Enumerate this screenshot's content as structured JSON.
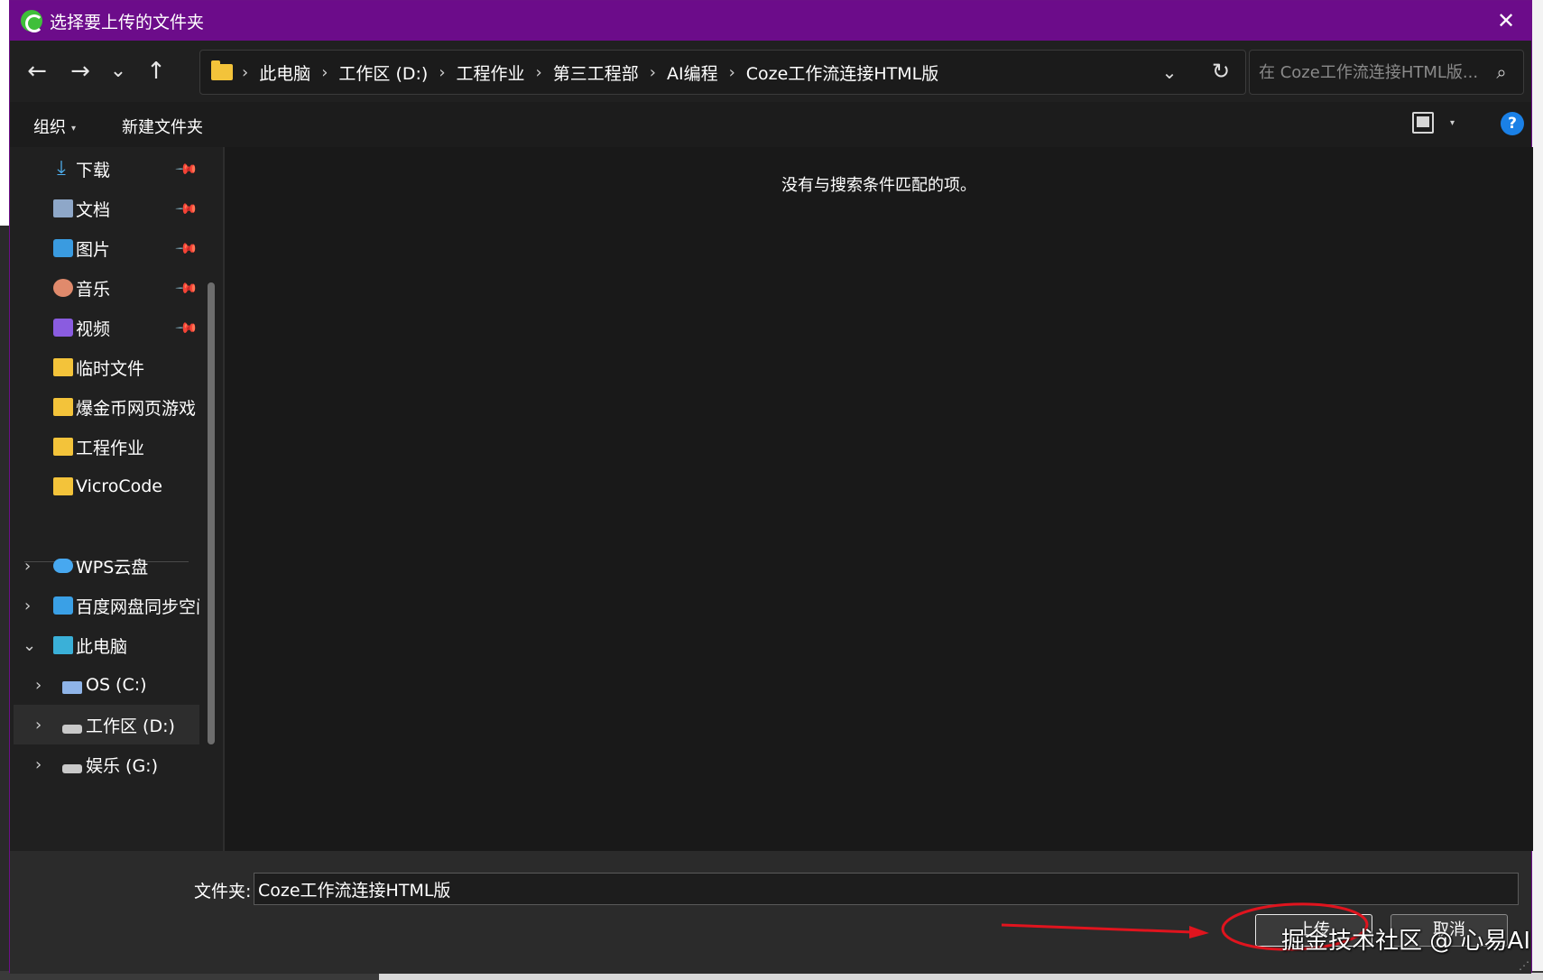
{
  "window": {
    "title": "选择要上传的文件夹",
    "close_glyph": "✕"
  },
  "nav": {
    "back_glyph": "←",
    "forward_glyph": "→",
    "recent_glyph": "⌄",
    "up_glyph": "↑",
    "breadcrumbs": [
      "此电脑",
      "工作区 (D:)",
      "工程作业",
      "第三工程部",
      "AI编程",
      "Coze工作流连接HTML版"
    ],
    "separator": "›",
    "dropdown_glyph": "⌄",
    "refresh_glyph": "↻",
    "search_placeholder": "在 Coze工作流连接HTML版...",
    "search_glyph": "⌕"
  },
  "toolbar": {
    "organize_label": "组织",
    "new_folder_label": "新建文件夹",
    "caret": "▾",
    "help_glyph": "?"
  },
  "sidebar": {
    "pin_glyph": "📌",
    "expand_glyph": "›",
    "collapse_glyph": "⌄",
    "quick_access": [
      {
        "label": "下载",
        "icon": "download-icon",
        "pinned": true
      },
      {
        "label": "文档",
        "icon": "document-icon",
        "pinned": true
      },
      {
        "label": "图片",
        "icon": "pictures-icon",
        "pinned": true
      },
      {
        "label": "音乐",
        "icon": "music-icon",
        "pinned": true
      },
      {
        "label": "视频",
        "icon": "video-icon",
        "pinned": true
      },
      {
        "label": "临时文件",
        "icon": "folder-icon",
        "pinned": false
      },
      {
        "label": "爆金币网页游戏",
        "icon": "folder-icon",
        "pinned": false
      },
      {
        "label": "工程作业",
        "icon": "folder-icon",
        "pinned": false
      },
      {
        "label": "VicroCode",
        "icon": "folder-icon",
        "pinned": false
      }
    ],
    "locations": [
      {
        "label": "WPS云盘",
        "icon": "cloud-icon",
        "expanded": false
      },
      {
        "label": "百度网盘同步空间",
        "icon": "baidu-netdisk-icon",
        "expanded": false
      },
      {
        "label": "此电脑",
        "icon": "computer-icon",
        "expanded": true
      }
    ],
    "drives": [
      {
        "label": "OS (C:)",
        "icon": "drive-c-icon",
        "selected": false
      },
      {
        "label": "工作区 (D:)",
        "icon": "drive-icon",
        "selected": true
      },
      {
        "label": "娱乐 (G:)",
        "icon": "drive-icon",
        "selected": false
      }
    ]
  },
  "content": {
    "empty_message": "没有与搜索条件匹配的项。"
  },
  "footer": {
    "folder_label": "文件夹:",
    "folder_value": "Coze工作流连接HTML版",
    "upload_label": "上传",
    "cancel_label": "取消"
  },
  "annotation": {
    "watermark": "掘金技术社区 @ 心易AI",
    "highlight_color": "#e0141e"
  },
  "colors": {
    "titlebar": "#6c0c8a",
    "background": "#202020",
    "accent": "#1a80e6",
    "folder": "#f3c33a"
  }
}
